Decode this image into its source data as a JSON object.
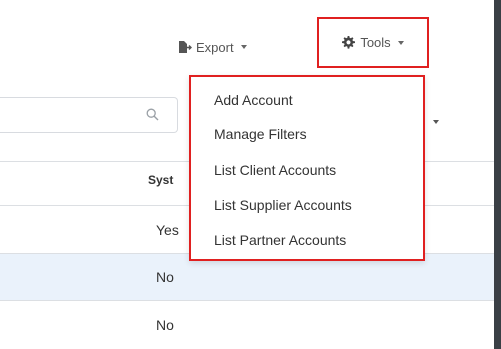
{
  "toolbar": {
    "export_label": "Export",
    "tools_label": "Tools"
  },
  "icons": {
    "export": "file-export-icon",
    "tools": "gear-icon",
    "search": "search-icon",
    "caret": "caret-down-icon"
  },
  "colors": {
    "highlight_border": "#e02020",
    "alt_row": "#eaf2fb"
  },
  "table": {
    "column_header": "Syst",
    "rows": [
      "Yes",
      "No",
      "No"
    ]
  },
  "tools_menu": {
    "items": [
      "Add Account",
      "Manage Filters",
      "List Client Accounts",
      "List Supplier Accounts",
      "List Partner Accounts"
    ]
  }
}
